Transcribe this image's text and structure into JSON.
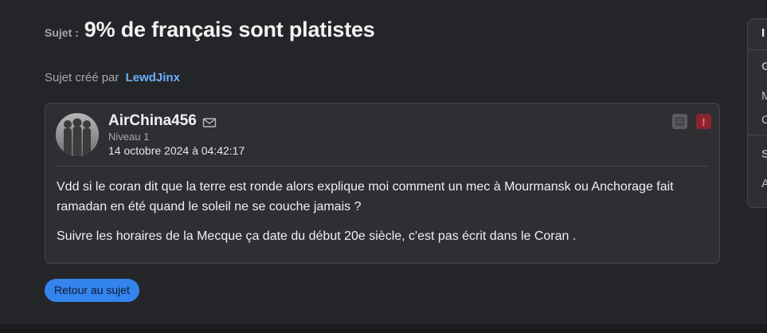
{
  "topic": {
    "prefix": "Sujet :",
    "title": "9% de français sont platistes",
    "created_by_label": "Sujet créé par",
    "author": "LewdJinx"
  },
  "post": {
    "username": "AirChina456",
    "level": "Niveau 1",
    "date": "14 octobre 2024 à 04:42:17",
    "paragraphs": [
      "Vdd si le coran dit que la terre est ronde alors explique moi comment un mec à Mourmansk ou Anchorage fait ramadan en été quand le soleil ne se couche jamais ?",
      "Suivre les horaires de la Mecque ça date du début 20e siècle, c'est pas écrit dans le Coran ."
    ],
    "icons": {
      "mail": "mail-icon",
      "neutral": "neutral-face-icon",
      "report": "exclamation-icon"
    },
    "report_glyph": "!"
  },
  "back_button": {
    "label": "Retour au sujet"
  },
  "side_panel": {
    "heading": "I",
    "section1": "G",
    "item1": "M",
    "item2": "C",
    "section2": "S",
    "item3": "A"
  },
  "colors": {
    "background": "#242528",
    "card": "#2e2f33",
    "link": "#6cb0ff",
    "primary_button": "#3384ec",
    "alert": "#8a2430"
  }
}
